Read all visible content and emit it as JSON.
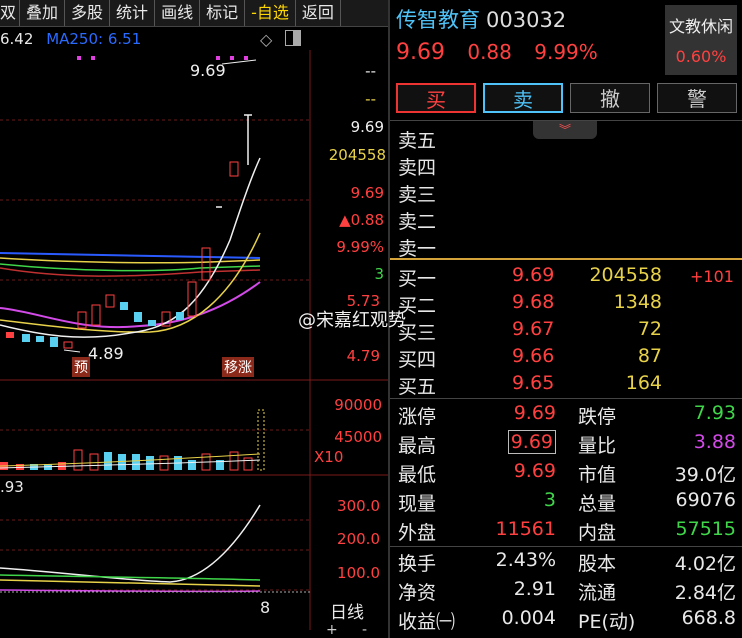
{
  "toolbar": {
    "items": [
      "双",
      "叠加",
      "多股",
      "统计",
      "画线",
      "标记",
      "-自选",
      "返回"
    ]
  },
  "chart": {
    "ma_prefix": "6.42",
    "ma250_label": "MA250: 6.51",
    "high_marker": "9.69",
    "low_marker": "4.89",
    "tag_yu": "预",
    "tag_limit": "移涨",
    "vol_axis": [
      "90000",
      "45000"
    ],
    "vol_multiplier": "X10",
    "ind_label": ".93",
    "ind_axis": [
      "300.0",
      "200.0",
      "100.0"
    ],
    "date_label": "8",
    "tab_label": "日线",
    "plus": "+",
    "minus": "-",
    "price_axis": {
      "dash1": "--",
      "dash2": "--",
      "price": "9.69",
      "volume": "204558",
      "price2": "9.69",
      "change": "▲0.88",
      "pct": "9.99%",
      "three": "3",
      "p573": "5.73",
      "p479": "4.79"
    }
  },
  "stock": {
    "name": "传智教育",
    "code": "003032",
    "price": "9.69",
    "change": "0.88",
    "pct": "9.99%",
    "sector_name": "文教休闲",
    "sector_pct": "0.60%"
  },
  "buttons": {
    "buy": "买",
    "sell": "卖",
    "cancel": "撤",
    "alert": "警"
  },
  "order_book": {
    "asks": [
      {
        "label": "卖五"
      },
      {
        "label": "卖四"
      },
      {
        "label": "卖三"
      },
      {
        "label": "卖二"
      },
      {
        "label": "卖一"
      }
    ],
    "bids": [
      {
        "label": "买一",
        "price": "9.69",
        "volume": "204558",
        "delta": "+101"
      },
      {
        "label": "买二",
        "price": "9.68",
        "volume": "1348"
      },
      {
        "label": "买三",
        "price": "9.67",
        "volume": "72"
      },
      {
        "label": "买四",
        "price": "9.66",
        "volume": "87"
      },
      {
        "label": "买五",
        "price": "9.65",
        "volume": "164"
      }
    ]
  },
  "stats": {
    "limit_up_label": "涨停",
    "limit_up": "9.69",
    "limit_down_label": "跌停",
    "limit_down": "7.93",
    "high_label": "最高",
    "high": "9.69",
    "vol_ratio_label": "量比",
    "vol_ratio": "3.88",
    "low_label": "最低",
    "low": "9.69",
    "mkt_cap_label": "市值",
    "mkt_cap": "39.0亿",
    "cur_vol_label": "现量",
    "cur_vol": "3",
    "total_vol_label": "总量",
    "total_vol": "69076",
    "outer_label": "外盘",
    "outer": "11561",
    "inner_label": "内盘",
    "inner": "57515",
    "turnover_label": "换手",
    "turnover": "2.43%",
    "shares_label": "股本",
    "shares": "4.02亿",
    "nav_label": "净资",
    "nav": "2.91",
    "float_label": "流通",
    "float": "2.84亿",
    "eps_label": "收益㈠",
    "eps": "0.004",
    "pe_label": "PE(动)",
    "pe": "668.8"
  },
  "watermark": "@宋嘉红观势",
  "colors": {
    "up": "#ff4040",
    "down": "#3fd64a",
    "accent": "#4fc3f7",
    "volume": "#e8d24a"
  }
}
